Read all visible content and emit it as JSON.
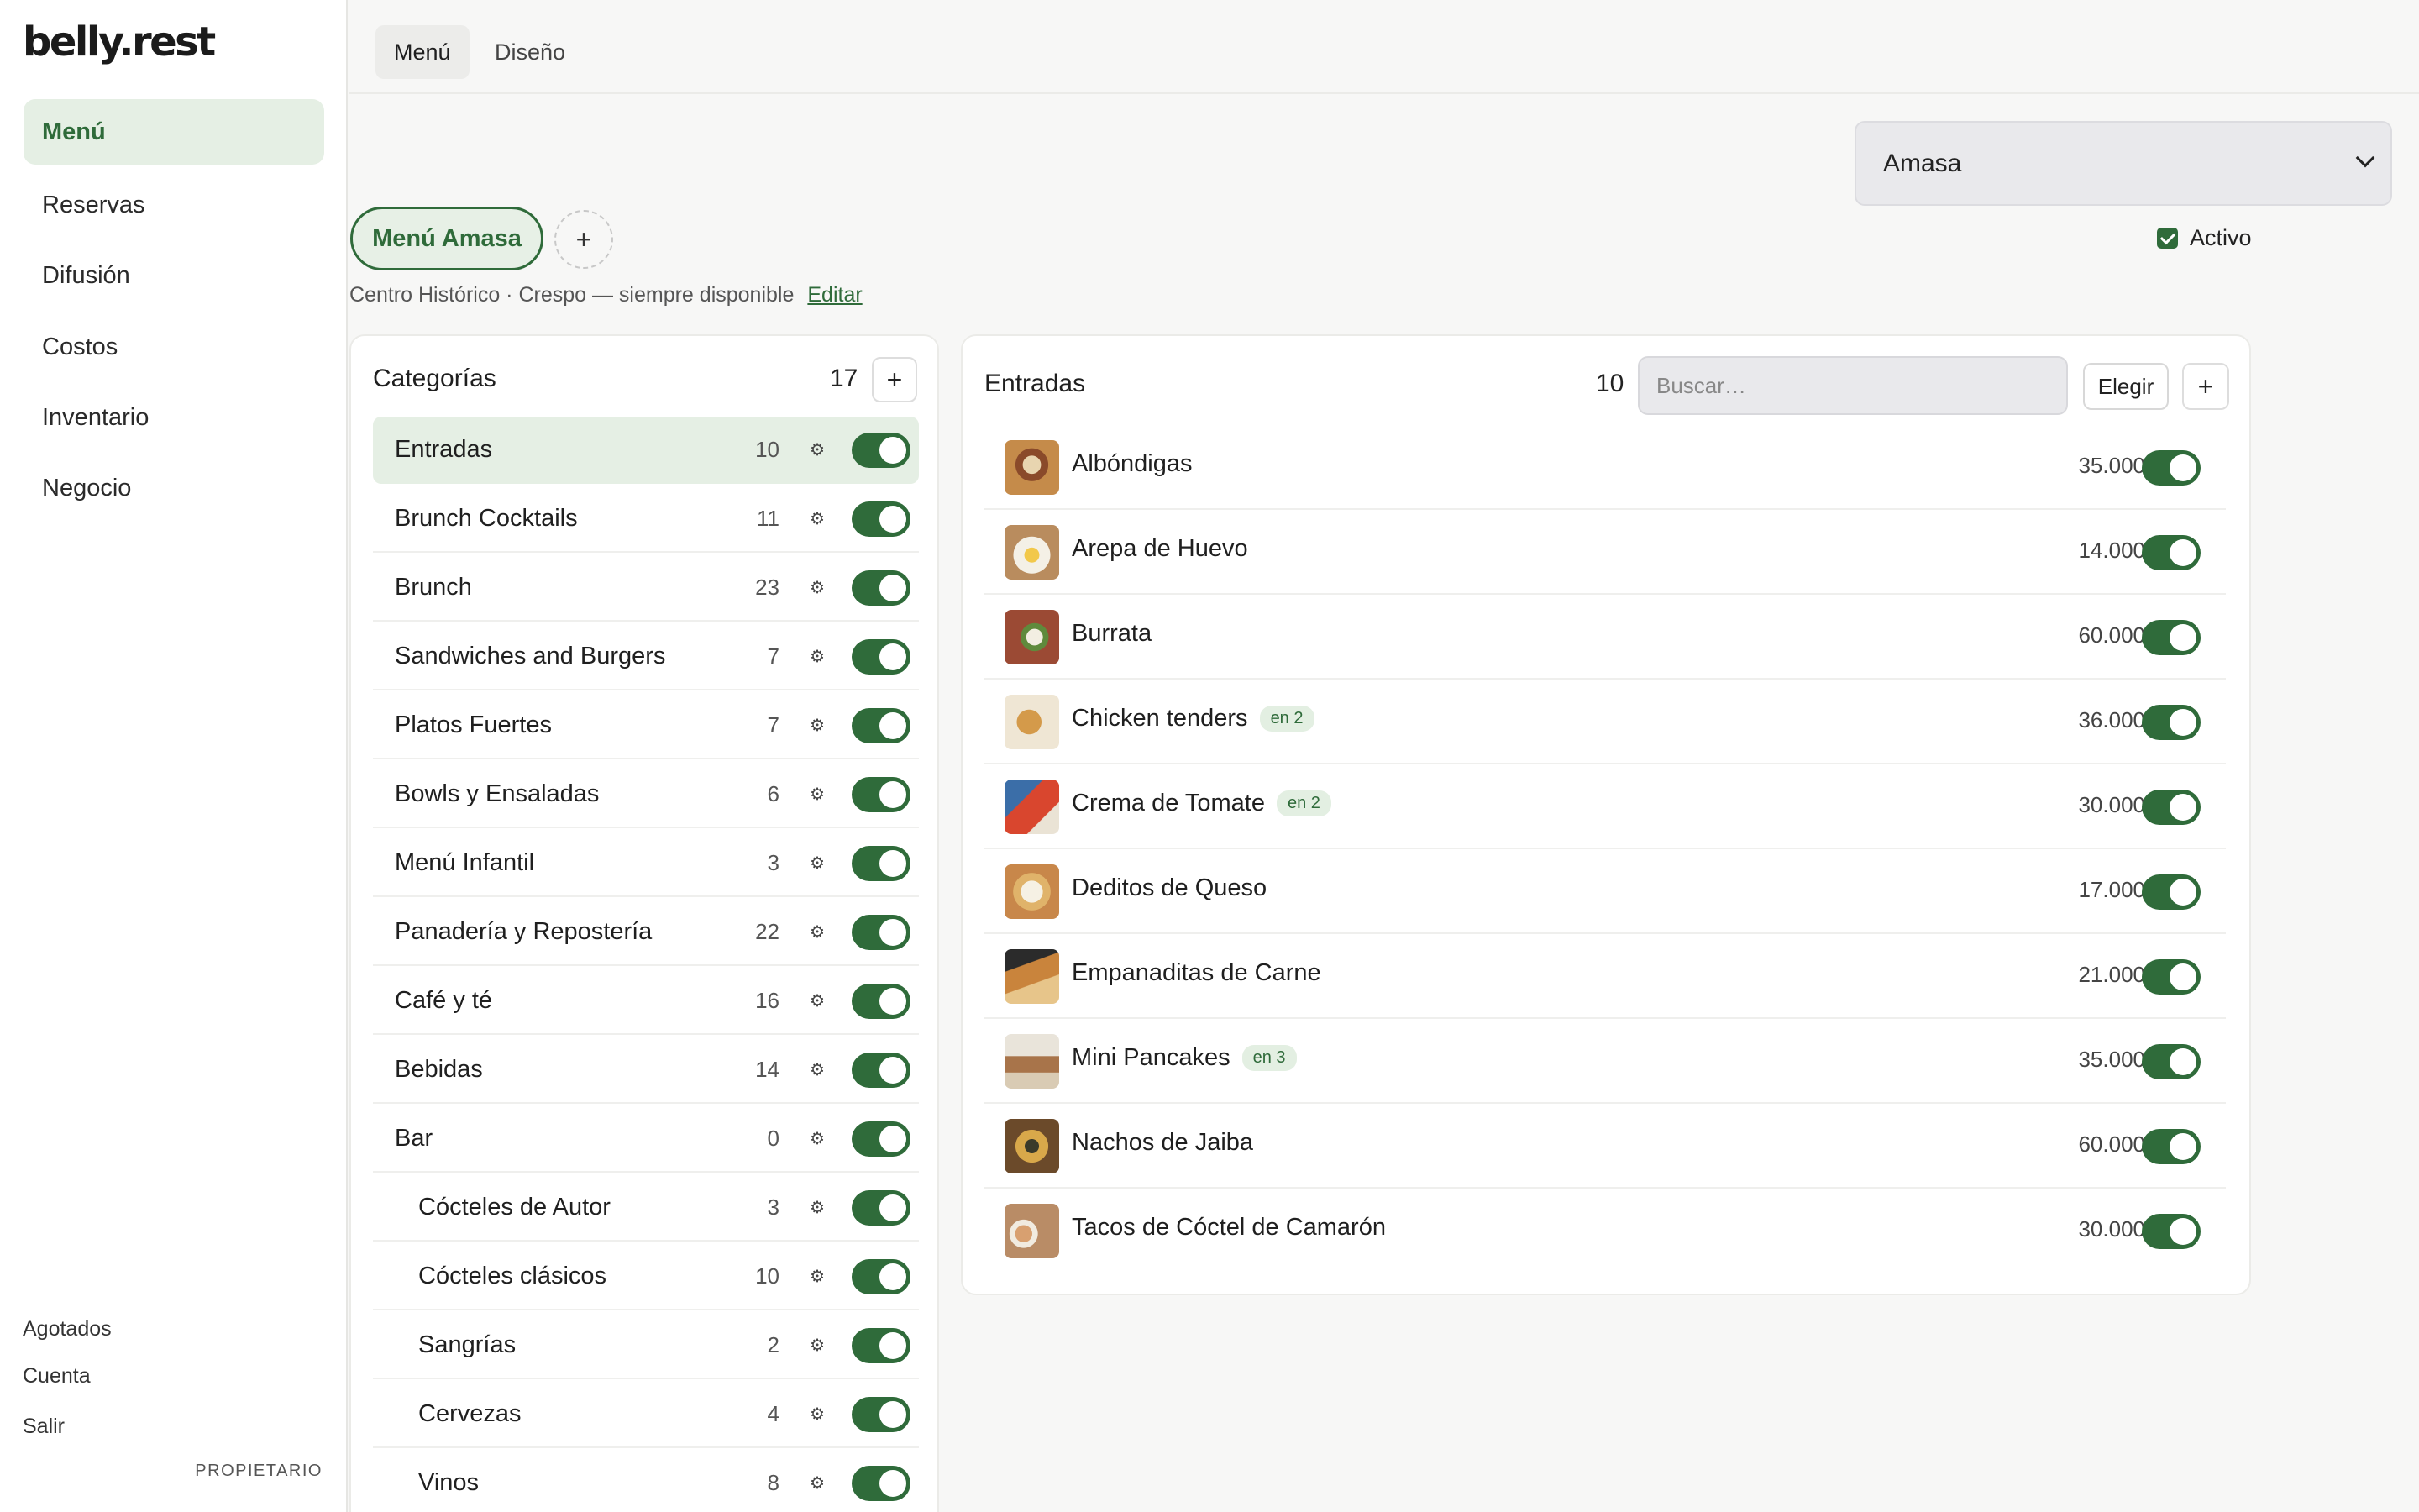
{
  "app": {
    "logo": "belly.rest"
  },
  "sidebar": {
    "items": [
      {
        "label": "Menú"
      },
      {
        "label": "Reservas"
      },
      {
        "label": "Difusión"
      },
      {
        "label": "Costos"
      },
      {
        "label": "Inventario"
      },
      {
        "label": "Negocio"
      }
    ],
    "footer": {
      "agotados": "Agotados",
      "cuenta": "Cuenta",
      "salir": "Salir",
      "role": "PROPIETARIO"
    }
  },
  "tabs": [
    {
      "label": "Menú"
    },
    {
      "label": "Diseño"
    }
  ],
  "restaurant": {
    "selected": "Amasa",
    "active_label": "Activo",
    "active": true
  },
  "menu": {
    "pill": "Menú Amasa",
    "add": "+",
    "info": "Centro Histórico · Crespo — siempre disponible",
    "edit": "Editar"
  },
  "categories": {
    "title": "Categorías",
    "count": "17",
    "add": "+",
    "items": [
      {
        "name": "Entradas",
        "count": "10",
        "gear": "⚙"
      },
      {
        "name": "Brunch Cocktails",
        "count": "11",
        "gear": "⚙"
      },
      {
        "name": "Brunch",
        "count": "23",
        "gear": "⚙"
      },
      {
        "name": "Sandwiches and Burgers",
        "count": "7",
        "gear": "⚙"
      },
      {
        "name": "Platos Fuertes",
        "count": "7",
        "gear": "⚙"
      },
      {
        "name": "Bowls y Ensaladas",
        "count": "6",
        "gear": "⚙"
      },
      {
        "name": "Menú Infantil",
        "count": "3",
        "gear": "⚙"
      },
      {
        "name": "Panadería y Repostería",
        "count": "22",
        "gear": "⚙"
      },
      {
        "name": "Café y té",
        "count": "16",
        "gear": "⚙"
      },
      {
        "name": "Bebidas",
        "count": "14",
        "gear": "⚙"
      },
      {
        "name": "Bar",
        "count": "0",
        "gear": "⚙"
      },
      {
        "name": "Cócteles de Autor",
        "count": "3",
        "gear": "⚙"
      },
      {
        "name": "Cócteles clásicos",
        "count": "10",
        "gear": "⚙"
      },
      {
        "name": "Sangrías",
        "count": "2",
        "gear": "⚙"
      },
      {
        "name": "Cervezas",
        "count": "4",
        "gear": "⚙"
      },
      {
        "name": "Vinos",
        "count": "8",
        "gear": "⚙"
      }
    ]
  },
  "items_panel": {
    "title": "Entradas",
    "count": "10",
    "search_placeholder": "Buscar…",
    "choose": "Elegir",
    "add": "+",
    "items": [
      {
        "name": "Albóndigas",
        "badge": "",
        "price": "35.000"
      },
      {
        "name": "Arepa de Huevo",
        "badge": "",
        "price": "14.000"
      },
      {
        "name": "Burrata",
        "badge": "",
        "price": "60.000"
      },
      {
        "name": "Chicken tenders",
        "badge": "en 2",
        "price": "36.000"
      },
      {
        "name": "Crema de Tomate",
        "badge": "en 2",
        "price": "30.000"
      },
      {
        "name": "Deditos de Queso",
        "badge": "",
        "price": "17.000"
      },
      {
        "name": "Empanaditas de Carne",
        "badge": "",
        "price": "21.000"
      },
      {
        "name": "Mini Pancakes",
        "badge": "en 3",
        "price": "35.000"
      },
      {
        "name": "Nachos de Jaiba",
        "badge": "",
        "price": "60.000"
      },
      {
        "name": "Tacos de Cóctel de Camarón",
        "badge": "",
        "price": "30.000"
      }
    ]
  },
  "colors": {
    "accent": "#2f6b3a",
    "accent_soft": "#e5efe4"
  }
}
